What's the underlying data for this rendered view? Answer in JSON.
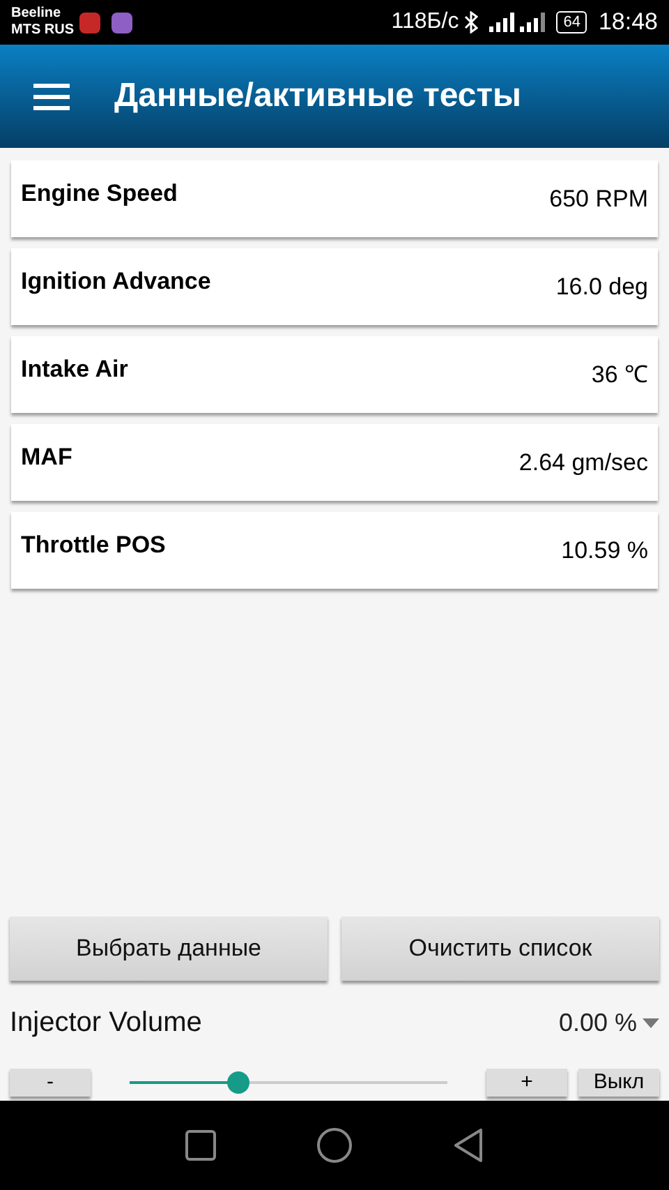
{
  "status_bar": {
    "carriers": [
      "Beeline",
      "MTS RUS"
    ],
    "speed": "118Б/с",
    "battery": "64",
    "time": "18:48"
  },
  "app_bar": {
    "title": "Данные/активные тесты"
  },
  "params": [
    {
      "name": "Engine Speed",
      "value": "650 RPM"
    },
    {
      "name": "Ignition Advance",
      "value": "16.0 deg"
    },
    {
      "name": "Intake Air",
      "value": "36 ℃"
    },
    {
      "name": "MAF",
      "value": "2.64 gm/sec"
    },
    {
      "name": "Throttle POS",
      "value": "10.59 %"
    }
  ],
  "buttons": [
    "Выбрать данные",
    "Очистить список"
  ],
  "active_test": {
    "name": "Injector Volume",
    "value": "0.00 %",
    "minus": "-",
    "plus": "+",
    "off": "Выкл",
    "level": 0.34
  }
}
